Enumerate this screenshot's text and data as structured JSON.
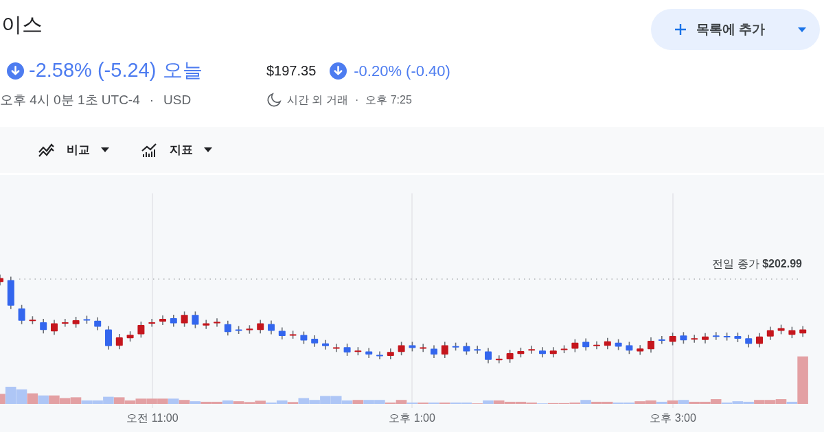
{
  "title": "이스",
  "quote": {
    "down": true,
    "change": "-2.58% (-5.24)",
    "period": "오늘",
    "timestamp": "오후 4시 0분 1초 UTC-4",
    "separator": "·",
    "currency": "USD"
  },
  "after_hours": {
    "price": "$197.35",
    "down": true,
    "change": "-0.20% (-0.40)",
    "label": "시간 외 거래",
    "separator": "·",
    "time": "오후 7:25"
  },
  "add_button": {
    "label": "목록에 추가"
  },
  "toolbar": [
    {
      "kind": "compare",
      "label": "비교"
    },
    {
      "kind": "indicators",
      "label": "지표"
    }
  ],
  "chart": {
    "previous_close": "전일 종가 **$202.99**",
    "x_labels": [
      "오전 11:00",
      "오후 1:00",
      "오후 3:00"
    ]
  }
}
